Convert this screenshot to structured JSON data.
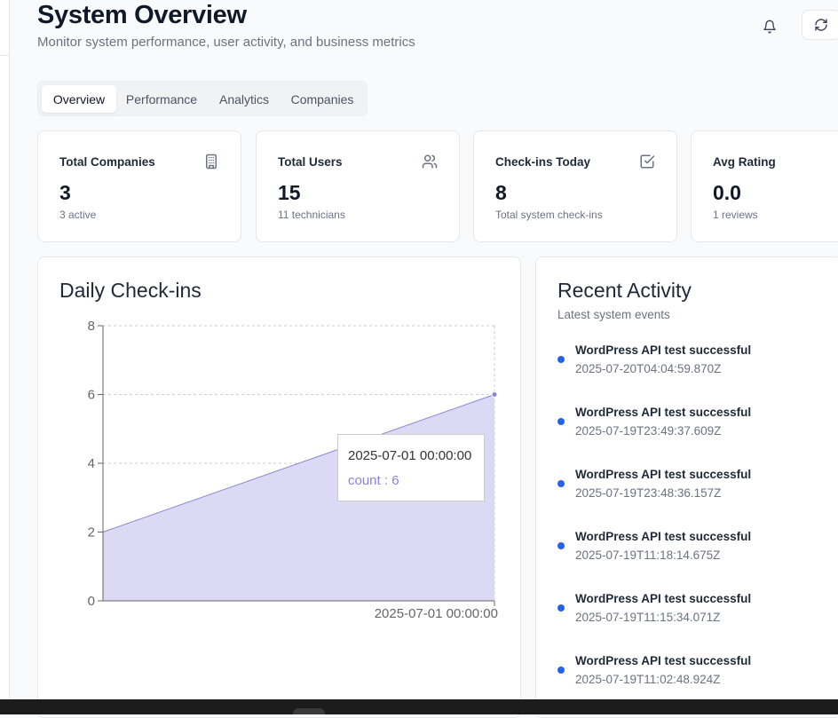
{
  "header": {
    "title": "System Overview",
    "subtitle": "Monitor system performance, user activity, and business metrics",
    "icons": {
      "notifications": "bell-icon",
      "refresh": "refresh-icon"
    }
  },
  "tabs": [
    {
      "label": "Overview",
      "active": true
    },
    {
      "label": "Performance",
      "active": false
    },
    {
      "label": "Analytics",
      "active": false
    },
    {
      "label": "Companies",
      "active": false
    }
  ],
  "stats": [
    {
      "label": "Total Companies",
      "value": "3",
      "sub": "3 active",
      "icon": "building-icon"
    },
    {
      "label": "Total Users",
      "value": "15",
      "sub": "11 technicians",
      "icon": "users-icon"
    },
    {
      "label": "Check-ins Today",
      "value": "8",
      "sub": "Total system check-ins",
      "icon": "check-square-icon"
    },
    {
      "label": "Avg Rating",
      "value": "0.0",
      "sub": "1 reviews",
      "icon": ""
    }
  ],
  "chart": {
    "title": "Daily Check-ins",
    "tooltip": {
      "label": "2025-07-01 00:00:00",
      "value_text": "count : 6"
    }
  },
  "chart_data": {
    "type": "area",
    "title": "Daily Check-ins",
    "x": [
      "",
      "2025-07-01 00:00:00"
    ],
    "series": [
      {
        "name": "count",
        "values": [
          2,
          6
        ]
      }
    ],
    "x_tick_labels": [
      "2025-07-01 00:00:00"
    ],
    "y_ticks": [
      "0",
      "2",
      "4",
      "6",
      "8"
    ],
    "ylim": [
      0,
      8
    ],
    "grid": true,
    "legend": "none",
    "colors": {
      "stroke": "#8884d8",
      "fill": "#dbd9f3"
    }
  },
  "activity": {
    "title": "Recent Activity",
    "subtitle": "Latest system events",
    "items": [
      {
        "title": "WordPress API test successful",
        "time": "2025-07-20T04:04:59.870Z"
      },
      {
        "title": "WordPress API test successful",
        "time": "2025-07-19T23:49:37.609Z"
      },
      {
        "title": "WordPress API test successful",
        "time": "2025-07-19T23:48:36.157Z"
      },
      {
        "title": "WordPress API test successful",
        "time": "2025-07-19T11:18:14.675Z"
      },
      {
        "title": "WordPress API test successful",
        "time": "2025-07-19T11:15:34.071Z"
      },
      {
        "title": "WordPress API test successful",
        "time": "2025-07-19T11:02:48.924Z"
      }
    ]
  },
  "colors": {
    "accent": "#2563eb",
    "chart_stroke": "#8884d8",
    "chart_fill": "#dbd9f3"
  }
}
